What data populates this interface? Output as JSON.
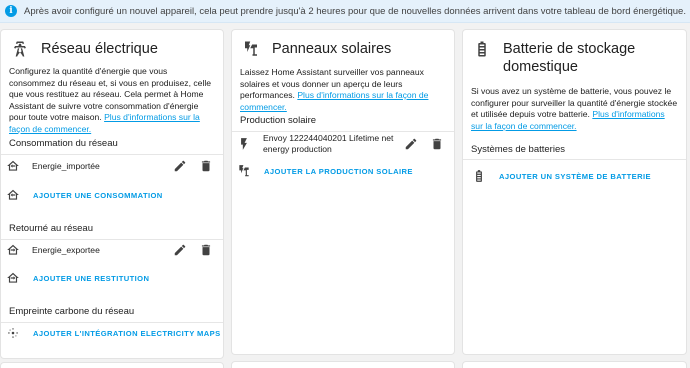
{
  "banner": {
    "icon": "info-icon",
    "text": "Après avoir configuré un nouvel appareil, cela peut prendre jusqu'à 2 heures pour que de nouvelles données arrivent dans votre tableau de bord énergétique."
  },
  "grid_card": {
    "title": "Réseau électrique",
    "description": "Configurez la quantité d'énergie que vous consommez du réseau et, si vous en produisez, celle que vous restituez au réseau. Cela permet à Home Assistant de suivre votre consommation d'énergie pour toute votre maison.",
    "more_link": "Plus d'informations sur la façon de commencer.",
    "consumption_title": "Consommation du réseau",
    "consumption_item": "Energie_importée",
    "add_consumption": "AJOUTER UNE CONSOMMATION",
    "return_title": "Retourné au réseau",
    "return_item": "Energie_exportee",
    "add_return": "AJOUTER UNE RESTITUTION",
    "carbon_title": "Empreinte carbone du réseau",
    "add_carbon": "AJOUTER L'INTÉGRATION ELECTRICITY MAPS"
  },
  "solar_card": {
    "title": "Panneaux solaires",
    "description": "Laissez Home Assistant surveiller vos panneaux solaires et vous donner un aperçu de leurs performances.",
    "more_link": "Plus d'informations sur la façon de commencer.",
    "production_title": "Production solaire",
    "production_item": "Envoy 122244040201 Lifetime net energy production",
    "add_production": "AJOUTER LA PRODUCTION SOLAIRE"
  },
  "battery_card": {
    "title": "Batterie de stockage domestique",
    "description": "Si vous avez un système de batterie, vous pouvez le configurer pour surveiller la quantité d'énergie stockée et utilisée depuis votre batterie.",
    "more_link": "Plus d'informations sur la façon de commencer.",
    "systems_title": "Systèmes de batteries",
    "add_battery": "AJOUTER UN SYSTÈME DE BATTERIE"
  },
  "colors": {
    "accent": "#039be5",
    "banner_bg": "#e5f1fb",
    "icon": "#424242",
    "text": "#212121"
  }
}
